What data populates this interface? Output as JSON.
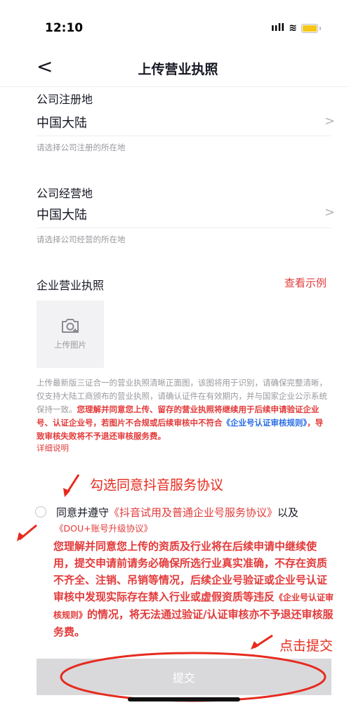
{
  "status": {
    "time": "12:10",
    "signal_glyph": "ııll",
    "wifi_glyph": "≋"
  },
  "nav": {
    "back_glyph": "<",
    "title": "上传营业执照"
  },
  "company_reg": {
    "label": "公司注册地",
    "value": "中国大陆",
    "hint": "请选择公司注册的所在地"
  },
  "company_op": {
    "label": "公司经营地",
    "value": "中国大陆",
    "hint": "请选择公司经营的所在地"
  },
  "chevron": ">",
  "license": {
    "label": "企业营业执照",
    "example_link": "查看示例",
    "upload_label": "上传图片"
  },
  "description": {
    "plain": "上传最新版三证合一的营业执照清晰正面图，该图将用于识别，请确保完整清晰，仅支持大陆工商颁布的营业执照，请确认证件在有效期内，并与国家企业公示系统保持一致。",
    "emphasis_1": "您理解并同意您上传、留存的营业执照将继续用于后续申请验证企业号、认证企业号，若图片不合规或后续审核中不符合",
    "rule_link": "《企业号认证审核规则》",
    "emphasis_2": "，导致审核失败将不予退还审核服务费。",
    "detail_link": "详细说明"
  },
  "annotations": {
    "check_agreement": "勾选同意抖音服务协议",
    "click_submit": "点击提交"
  },
  "agreement": {
    "prefix": "同意并遵守",
    "link_1": "《抖音试用及普通企业号服务协议》",
    "middle": "以及",
    "link_2": "《DOU+账号升级协议》",
    "warning_1": "您理解并同意您上传的资质及行业将在后续申请中继续使用，提交申请前请务必确保所选行业真实准确，不存在资质不齐全、注销、吊销等情况，后续企业号验证或企业号认证审核中发现实际存在禁入行业或虚假资质等违反",
    "warning_rule": "《企业号认证审核规则》",
    "warning_2": "的情况，将无法通过验证/认证审核亦不予退还审核服务费。"
  },
  "submit_label": "提交",
  "colors": {
    "accent_red": "#e33a3a",
    "annotation_red": "#e62b1e",
    "link_blue": "#2b6ee6",
    "button_disabled": "#d9d9dc"
  }
}
